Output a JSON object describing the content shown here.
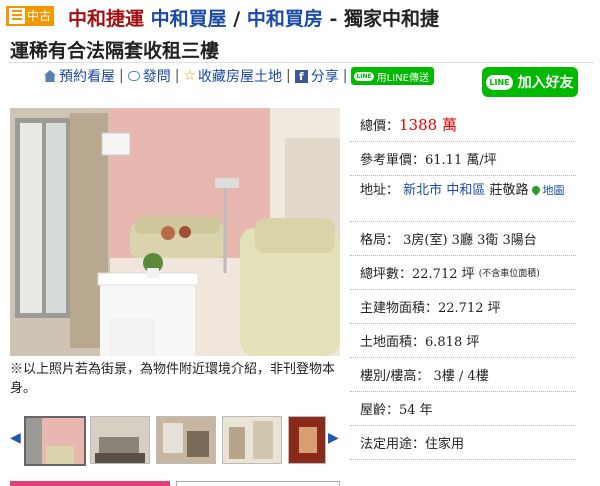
{
  "header": {
    "badge": "中古",
    "crumb1": "中和捷運",
    "crumb2": "中和買屋",
    "slash": "/",
    "crumb3": "中和買房",
    "dash": "-",
    "title_line1": "獨家中和捷",
    "title_line2": "運稀有合法隔套收租三樓"
  },
  "actions": {
    "book": "預約看屋",
    "ask": "發問",
    "save": "收藏房屋土地",
    "share": "分享",
    "line_send": "用LINE傳送",
    "line_add": "加入好友",
    "line_logo": "LINE",
    "sep": "|"
  },
  "photo": {
    "caption": "※以上照片若為街景，為物件附近環境介紹，非刊登物本身。"
  },
  "thumbs": {
    "prev": "◀",
    "next": "▶",
    "count": 5
  },
  "info": {
    "price_label": "總價：",
    "price_value": "1388 萬",
    "unit_price": "參考單價：61.11 萬/坪",
    "addr_label": "地址：",
    "addr_city": "新北市",
    "addr_dist": "中和區",
    "addr_road": "莊敬路",
    "map_link": "地圖",
    "layout": "格局： 3房(室) 3廳 3衛 3陽台",
    "total_area": "總坪數：22.712 坪",
    "total_area_note": "(不含車位面積)",
    "main_area": "主建物面積：22.712 坪",
    "land_area": "土地面積：6.818 坪",
    "floor": "樓別/樓高： 3樓 / 4樓",
    "age": "屋齡：54 年",
    "use": "法定用途：住家用"
  },
  "colors": {
    "accent_red": "#a01010",
    "link_blue": "#1a4aa8",
    "line_green": "#00b900",
    "badge_orange": "#f39800"
  }
}
